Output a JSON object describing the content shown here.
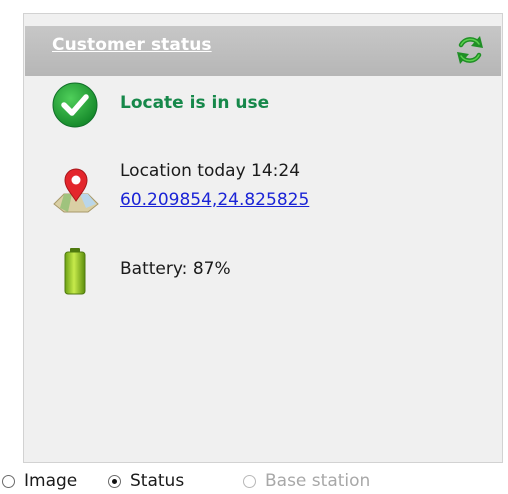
{
  "header": {
    "title": "Customer status",
    "refresh_icon": "refresh-icon"
  },
  "status": {
    "icon": "check-circle-icon",
    "text": "Locate is in use",
    "color": "#16884a"
  },
  "location": {
    "icon": "map-pin-icon",
    "label": "Location today 14:24",
    "coordinates": "60.209854,24.825825"
  },
  "battery": {
    "icon": "battery-icon",
    "text": "Battery: 87%",
    "level": 0.87
  },
  "view_options": {
    "items": [
      {
        "label": "Image",
        "checked": false,
        "enabled": true
      },
      {
        "label": "Status",
        "checked": true,
        "enabled": true
      },
      {
        "label": "Base station",
        "checked": false,
        "enabled": false
      }
    ]
  }
}
